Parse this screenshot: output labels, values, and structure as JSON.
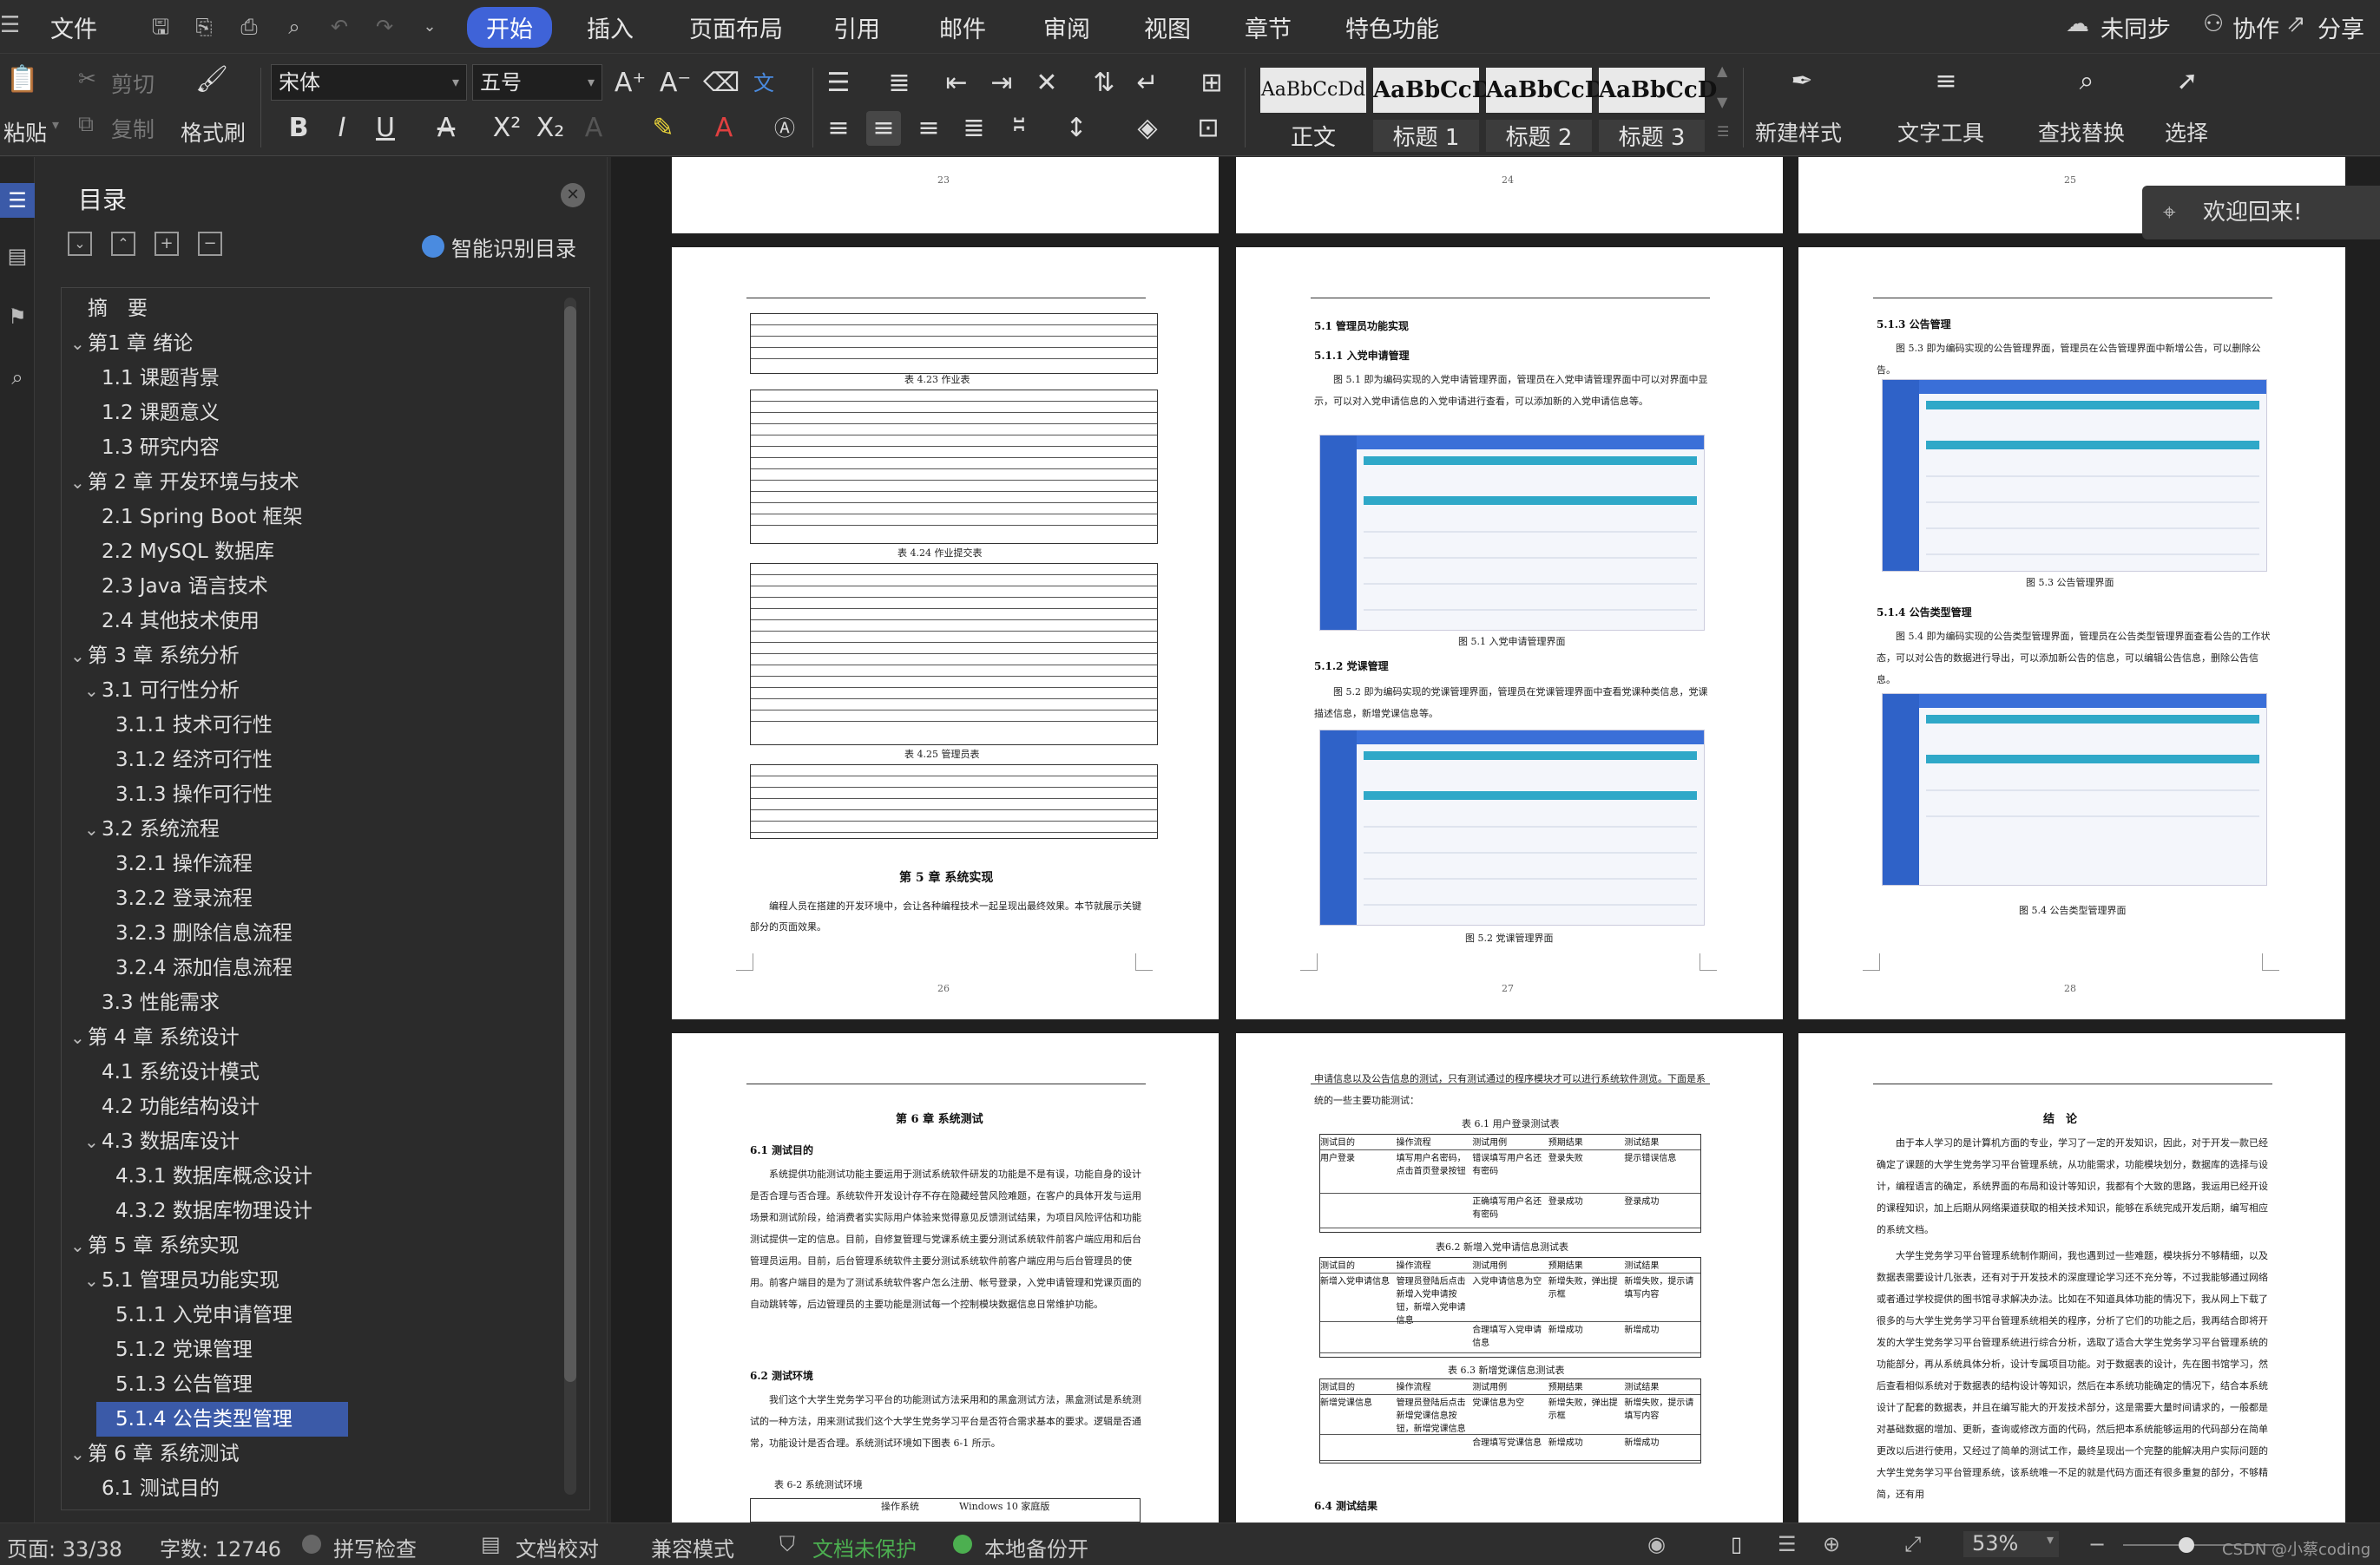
{
  "menubar": {
    "file": "文件",
    "tabs": [
      "开始",
      "插入",
      "页面布局",
      "引用",
      "邮件",
      "审阅",
      "视图",
      "章节",
      "特色功能"
    ],
    "sync": "未同步",
    "collab": "协作",
    "share": "分享"
  },
  "ribbon": {
    "paste": "粘贴",
    "cut": "剪切",
    "copy": "复制",
    "format_painter": "格式刷",
    "font_name": "宋体",
    "font_size": "五号",
    "styles": [
      {
        "preview": "AaBbCcDd",
        "label": "正文"
      },
      {
        "preview": "AaBbCcD",
        "label": "标题 1"
      },
      {
        "preview": "AaBbCcD",
        "label": "标题 2"
      },
      {
        "preview": "AaBbCcD",
        "label": "标题 3"
      }
    ],
    "new_style": "新建样式",
    "text_tools": "文字工具",
    "find_replace": "查找替换",
    "select": "选择"
  },
  "toc": {
    "title": "目录",
    "smart": "智能识别目录",
    "items": [
      {
        "label": "摘　要",
        "level": 1,
        "chev": false
      },
      {
        "label": "第1 章  绪论",
        "level": 1,
        "chev": true
      },
      {
        "label": "1.1 课题背景",
        "level": 2,
        "chev": false
      },
      {
        "label": "1.2 课题意义",
        "level": 2,
        "chev": false
      },
      {
        "label": "1.3 研究内容",
        "level": 2,
        "chev": false
      },
      {
        "label": "第 2 章  开发环境与技术",
        "level": 1,
        "chev": true
      },
      {
        "label": "2.1 Spring Boot 框架",
        "level": 2,
        "chev": false
      },
      {
        "label": "2.2 MySQL 数据库",
        "level": 2,
        "chev": false
      },
      {
        "label": "2.3 Java 语言技术",
        "level": 2,
        "chev": false
      },
      {
        "label": "2.4  其他技术使用",
        "level": 2,
        "chev": false
      },
      {
        "label": "第 3 章  系统分析",
        "level": 1,
        "chev": true
      },
      {
        "label": "3.1  可行性分析",
        "level": 2,
        "chev": true
      },
      {
        "label": "3.1.1  技术可行性",
        "level": 3,
        "chev": false
      },
      {
        "label": "3.1.2  经济可行性",
        "level": 3,
        "chev": false
      },
      {
        "label": "3.1.3  操作可行性",
        "level": 3,
        "chev": false
      },
      {
        "label": "3.2  系统流程",
        "level": 2,
        "chev": true
      },
      {
        "label": "3.2.1  操作流程",
        "level": 3,
        "chev": false
      },
      {
        "label": "3.2.2  登录流程",
        "level": 3,
        "chev": false
      },
      {
        "label": "3.2.3  删除信息流程",
        "level": 3,
        "chev": false
      },
      {
        "label": "3.2.4  添加信息流程",
        "level": 3,
        "chev": false
      },
      {
        "label": "3.3  性能需求",
        "level": 2,
        "chev": false
      },
      {
        "label": "第 4 章  系统设计",
        "level": 1,
        "chev": true
      },
      {
        "label": "4.1  系统设计模式",
        "level": 2,
        "chev": false
      },
      {
        "label": "4.2  功能结构设计",
        "level": 2,
        "chev": false
      },
      {
        "label": "4.3  数据库设计",
        "level": 2,
        "chev": true
      },
      {
        "label": "4.3.1  数据库概念设计",
        "level": 3,
        "chev": false
      },
      {
        "label": "4.3.2  数据库物理设计",
        "level": 3,
        "chev": false
      },
      {
        "label": "第 5 章  系统实现",
        "level": 1,
        "chev": true
      },
      {
        "label": "5.1  管理员功能实现",
        "level": 2,
        "chev": true
      },
      {
        "label": "5.1.1  入党申请管理",
        "level": 3,
        "chev": false
      },
      {
        "label": "5.1.2  党课管理",
        "level": 3,
        "chev": false
      },
      {
        "label": "5.1.3  公告管理",
        "level": 3,
        "chev": false
      },
      {
        "label": "5.1.4  公告类型管理",
        "level": 3,
        "chev": false,
        "selected": true
      },
      {
        "label": "第 6 章  系统测试",
        "level": 1,
        "chev": true
      },
      {
        "label": "6.1 测试目的",
        "level": 2,
        "chev": false
      }
    ]
  },
  "pages": {
    "top_numbers": [
      "23",
      "24",
      "25"
    ],
    "p26": {
      "cap23": "表 4.23 作业表",
      "cap24": "表 4.24 作业提交表",
      "cap25": "表 4.25 管理员表",
      "heading": "第 5 章  系统实现",
      "body": "编程人员在搭建的开发环境中，会让各种编程技术一起呈现出最终效果。本节就展示关键部分的页面效果。",
      "num": "26"
    },
    "p27": {
      "h1": "5.1  管理员功能实现",
      "h2": "5.1.1  入党申请管理",
      "t1": "图 5.1 即为编码实现的入党申请管理界面，管理员在入党申请管理界面中可以对界面中显示，可以对入党申请信息的入党申请进行查看，可以添加新的入党申请信息等。",
      "cap1": "图 5.1  入党申请管理界面",
      "h3": "5.1.2  党课管理",
      "t2": "图 5.2 即为编码实现的党课管理界面，管理员在党课管理界面中查看党课种类信息，党课描述信息，新增党课信息等。",
      "cap2": "图 5.2  党课管理界面",
      "num": "27"
    },
    "p28": {
      "h1": "5.1.3  公告管理",
      "t1": "图 5.3 即为编码实现的公告管理界面，管理员在公告管理界面中新增公告，可以删除公告。",
      "cap1": "图 5.3  公告管理界面",
      "h2": "5.1.4  公告类型管理",
      "t2": "图 5.4 即为编码实现的公告类型管理界面，管理员在公告类型管理界面查看公告的工作状态，可以对公告的数据进行导出，可以添加新公告的信息，可以编辑公告信息，删除公告信息。",
      "cap2": "图 5.4  公告类型管理界面",
      "num": "28"
    },
    "p29": {
      "heading": "第 6 章  系统测试",
      "h1": "6.1 测试目的",
      "t1": "系统提供功能测试功能主要运用于测试系统软件研发的功能是不是有误，功能自身的设计是否合理与否合理。系统软件开发设计存不存在隐藏经营风险难题，在客户的具体开发与运用场景和测试阶段，给消费者实实际用户体验来觉得意见反馈测试结果，为项目风险评估和功能测试提供一定的信息。目前，自修复管理与党课系统主要分测试系统软件前客户端应用和后台管理员运用。目前，后台管理系统软件主要分测试系统软件前客户端应用与后台管理员的使用。前客户端目的是为了测试系统软件客户怎么注册、帐号登录，入党申请管理和党课页面的自动跳转等，后边管理员的主要功能是测试每一个控制模块数据信息日常维护功能。",
      "h2": "6.2 测试环境",
      "t2": "我们这个大学生党务学习平台的功能测试方法采用和的黑盒测试方法，黑盒测试是系统测试的一种方法，用来测试我们这个大学生党务学习平台是否符合需求基本的要求。逻辑是否通常，功能设计是否合理。系统测试环境如下图表 6-1 所示。",
      "cap": "表 6-2 系统测试环境",
      "tbl_a": "操作系统",
      "tbl_b": "Windows 10 家庭版"
    },
    "p30": {
      "t0": "申请信息以及公告信息的测试，只有测试通过的程序模块才可以进行系统软件测览。下面是系统的一些主要功能测试：",
      "cap1": "表 6.1   用户登录测试表",
      "headers": [
        "测试目的",
        "操作流程",
        "测试用例",
        "预期结果",
        "测试结果"
      ],
      "r1": [
        "用户登录",
        "填写用户名密码，点击首页登录按钮",
        "错误填写用户名还有密码",
        "登录失败",
        "提示错误信息"
      ],
      "r2": [
        "",
        "",
        "正确填写用户名还有密码",
        "登录成功",
        "登录成功"
      ],
      "cap2": "表6.2 新增入党申请信息测试表",
      "r3": [
        "新增入党申请信息",
        "管理员登陆后点击新增入党申请按钮，新增入党申请信息",
        "入党申请信息为空",
        "新增失败，弹出提示框",
        "新增失败，提示请填写内容"
      ],
      "r4": [
        "",
        "",
        "合理填写入党申请信息",
        "新增成功",
        "新增成功"
      ],
      "cap3": "表 6.3 新增党课信息测试表",
      "r5": [
        "新增党课信息",
        "管理员登陆后点击新增党课信息按钮，新增党课信息",
        "党课信息为空",
        "新增失败，弹出提示框",
        "新增失败，提示请填写内容"
      ],
      "r6": [
        "",
        "",
        "合理填写党课信息",
        "新增成功",
        "新增成功"
      ],
      "h": "6.4 测试结果"
    },
    "p31": {
      "heading": "结　论",
      "t1": "由于本人学习的是计算机方面的专业，学习了一定的开发知识，因此，对于开发一款已经确定了课题的大学生党务学习平台管理系统，从功能需求，功能模块划分，数据库的选择与设计，编程语言的确定，系统界面的布局和设计等知识，我都有个大致的思路，我运用已经开设的课程知识，加上后期从网络渠道获取的相关技术知识，能够在系统完成开发后期，编写相应的系统文档。",
      "t2": "大学生党务学习平台管理系统制作期间，我也遇到过一些难题，模块拆分不够精细，以及数据表需要设计几张表，还有对于开发技术的深度理论学习还不充分等，不过我能够通过网络或者通过学校提供的图书馆寻求解决办法。比如在不知道具体功能的情况下，我从网上下载了很多的与大学生党务学习平台管理系统相关的程序，分析了它们的功能之后，我再结合即将开发的大学生党务学习平台管理系统进行综合分析，选取了适合大学生党务学习平台管理系统的功能部分，再从系统具体分析，设计专属项目功能。对于数据表的设计，先在图书馆学习，然后查看相似系统对于数据表的结构设计等知识，然后在本系统功能确定的情况下，结合本系统设计了配套的数据表，并且在编写能大的开发技术部分，这是需要大量时间请求的，一般都是对基础数据的增加、更新，查询或修改方面的代码，然后把本系统能够运用的代码部分在简单更改以后进行使用，又经过了简单的测试工作，最终呈现出一个完整的能解决用户实际问题的大学生党务学习平台管理系统，该系统唯一不足的就是代码方面还有很多重复的部分，不够精简，还有用"
    }
  },
  "toast": "欢迎回来!",
  "status": {
    "page": "页面: 33/38",
    "words": "字数: 12746",
    "spell": "拼写检查",
    "proof": "文档校对",
    "compat": "兼容模式",
    "protect": "文档未保护",
    "backup": "本地备份开",
    "zoom": "53%",
    "watermark": "CSDN @小蔡coding"
  },
  "colors": {
    "accent": "#3f63d8",
    "protect": "#4caf50",
    "toc_selected": "#3b5aa8"
  }
}
